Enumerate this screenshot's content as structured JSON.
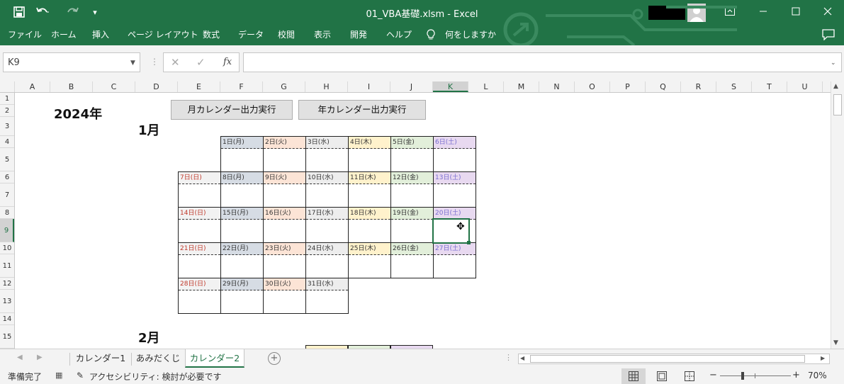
{
  "window": {
    "title": "01_VBA基礎.xlsm  -  Excel",
    "quick_access": {
      "save_icon": "save-icon",
      "undo_icon": "undo-icon",
      "redo_icon": "redo-icon",
      "more": "▾"
    }
  },
  "ribbon": {
    "tabs": [
      "ファイル",
      "ホーム",
      "挿入",
      "ページ レイアウト",
      "数式",
      "データ",
      "校閲",
      "表示",
      "開発",
      "ヘルプ"
    ],
    "tell_me": "何をしますか"
  },
  "formula_bar": {
    "name_box": "K9",
    "formula": "",
    "fx_label": "fx"
  },
  "columns": [
    "A",
    "B",
    "C",
    "D",
    "E",
    "F",
    "G",
    "H",
    "I",
    "J",
    "K",
    "L",
    "M",
    "N",
    "O",
    "P",
    "Q",
    "R",
    "S",
    "T",
    "U"
  ],
  "rows": [
    "1",
    "2",
    "3",
    "4",
    "5",
    "6",
    "7",
    "8",
    "9",
    "10",
    "11",
    "12",
    "13",
    "14",
    "15"
  ],
  "sheet": {
    "year_label": "2024年",
    "month_button": "月カレンダー出力実行",
    "year_button": "年カレンダー出力実行",
    "month1": "1月",
    "month2": "2月",
    "weeks": [
      [
        "",
        "",
        "1日(月)",
        "2日(火)",
        "3日(水)",
        "4日(木)",
        "5日(金)",
        "6日(土)"
      ],
      [
        "",
        "7日(日)",
        "8日(月)",
        "9日(火)",
        "10日(水)",
        "11日(木)",
        "12日(金)",
        "13日(土)"
      ],
      [
        "",
        "14日(日)",
        "15日(月)",
        "16日(火)",
        "17日(水)",
        "18日(木)",
        "19日(金)",
        "20日(土)"
      ],
      [
        "",
        "21日(日)",
        "22日(月)",
        "23日(火)",
        "24日(水)",
        "25日(木)",
        "26日(金)",
        "27日(土)"
      ],
      [
        "",
        "28日(日)",
        "29日(月)",
        "30日(火)",
        "31日(水)",
        "",
        "",
        ""
      ]
    ],
    "weekday_colors": {
      "sun": {
        "bg": "#f2f2f2",
        "fg": "#c0392b"
      },
      "mon": {
        "bg": "#d6dce4",
        "fg": "#333333"
      },
      "tue": {
        "bg": "#fce4d6",
        "fg": "#333333"
      },
      "wed": {
        "bg": "#ededed",
        "fg": "#333333"
      },
      "thu": {
        "bg": "#fff2cc",
        "fg": "#333333"
      },
      "fri": {
        "bg": "#e2efda",
        "fg": "#333333"
      },
      "sat": {
        "bg": "#e8d9f0",
        "fg": "#7a6fd0"
      }
    }
  },
  "sheet_tabs": [
    "カレンダー1",
    "あみだくじ",
    "カレンダー2"
  ],
  "active_tab": "カレンダー2",
  "status": {
    "ready": "準備完了",
    "accessibility": "アクセシビリティ: 検討が必要です",
    "zoom": "70%"
  }
}
